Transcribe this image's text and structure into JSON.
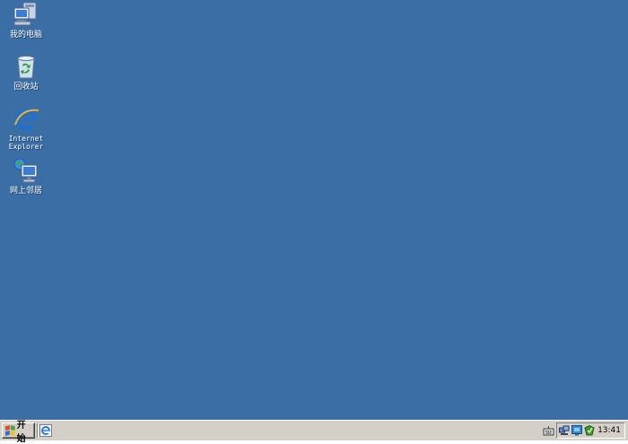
{
  "desktop": {
    "background_color": "#3a6ea5",
    "icons": [
      {
        "label": "我的电脑",
        "icon": "my-computer-icon"
      },
      {
        "label": "回收站",
        "icon": "recycle-bin-icon"
      },
      {
        "label": "Internet\nExplorer",
        "icon": "internet-explorer-icon"
      },
      {
        "label": "网上邻居",
        "icon": "network-places-icon"
      }
    ]
  },
  "taskbar": {
    "start_label": "开始",
    "quick_launch": [
      "internet-explorer-icon"
    ],
    "tray_icons": [
      "keyboard-icon",
      "network-icon",
      "monitor-icon",
      "security-icon"
    ],
    "clock": "13:41"
  }
}
